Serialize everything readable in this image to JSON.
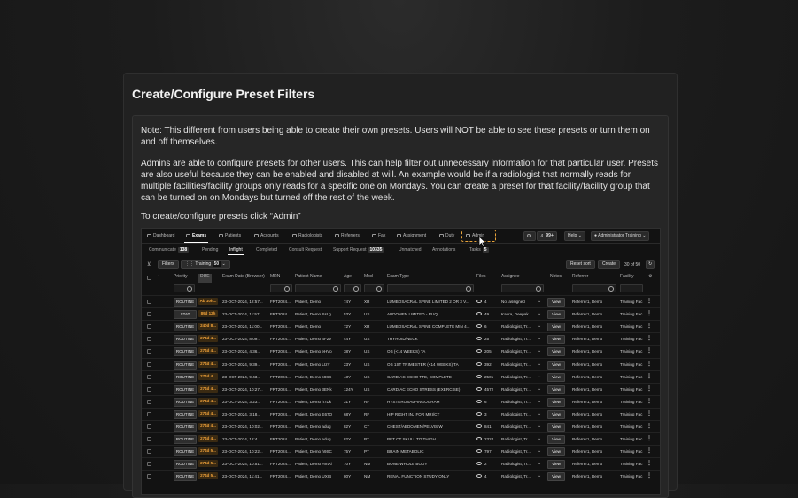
{
  "panel": {
    "title": "Create/Configure Preset Filters",
    "note": "Note: This different from users being able to create their own presets. Users will NOT be able to see these presets or turn them on and off themselves.",
    "description": "Admins are able to configure presets for other users. This can help filter out unnecessary information for that particular user. Presets are also useful because they can be enabled and disabled at will. An example would be if a radiologist that normally reads for multiple facilities/facility groups only reads for a specific one on Mondays. You can create a preset for that facility/facility group that can be turned on on Mondays but turned off the rest of the week.",
    "instruction": "To create/configure presets click “Admin”"
  },
  "app": {
    "nav": [
      "Dashboard",
      "Exams",
      "Patients",
      "Accounts",
      "Radiologists",
      "Referrers",
      "Fax",
      "Assignment",
      "Duty",
      "Admin"
    ],
    "active_nav": "Exams",
    "notif_count": "99+",
    "help_label": "Help",
    "user_name": "Administrator Training",
    "tabs": [
      {
        "label": "Communicate",
        "count": "138"
      },
      {
        "label": "Pending",
        "count": ""
      },
      {
        "label": "Inflight",
        "count": ""
      },
      {
        "label": "Completed",
        "count": ""
      },
      {
        "label": "Consult Request",
        "count": ""
      },
      {
        "label": "Support Request",
        "count": "10335"
      },
      {
        "label": "Unmatched",
        "count": ""
      },
      {
        "label": "Annotations",
        "count": ""
      },
      {
        "label": "Tasks",
        "count": "5"
      }
    ],
    "active_tab": "Inflight",
    "filters_label": "Filters",
    "preset_label": "Training",
    "preset_count": "50",
    "reset_sort_label": "Reset sort",
    "create_label": "Create",
    "pagination": "30 of 50",
    "columns": [
      "Priority",
      "DUE",
      "Exam Date (Browser)",
      "MRN",
      "Patient Name",
      "Age",
      "Mod",
      "Exam Type",
      "Files",
      "Assignee",
      "Notes",
      "Referrer",
      "Facility"
    ],
    "rows": [
      {
        "priority": "ROUTINE",
        "due": "Ab 10h...",
        "date": "23-OCT-2024, 12:57...",
        "mrn": "FRT2024...",
        "name": "Patient, Demo",
        "age": "74Y",
        "mod": "XR",
        "exam": "LUMBOSACRAL SPINE LIMITED 2 OR 3 V...",
        "files": "4",
        "assignee": "Not assigned",
        "referrer": "Referrer1, Demo",
        "facility": "Training Fac"
      },
      {
        "priority": "STAT",
        "due": "89d 12h",
        "date": "23-OCT-2024, 11:57...",
        "mrn": "FRT2024...",
        "name": "Patient, Demo SsLg",
        "age": "53Y",
        "mod": "US",
        "exam": "ABDOMEN LIMITED - RUQ",
        "files": "49",
        "assignee": "Kaura, Deepak",
        "referrer": "Referrer1, Demo",
        "facility": "Training Fac"
      },
      {
        "priority": "ROUTINE",
        "due": "240d 8...",
        "date": "23-OCT-2024, 11:00...",
        "mrn": "FRT2024...",
        "name": "Patient, Demo",
        "age": "72Y",
        "mod": "XR",
        "exam": "LUMBOSACRAL SPINE COMPLETE MIN 4...",
        "files": "6",
        "assignee": "Radiologist, Tr...",
        "referrer": "Referrer1, Demo",
        "facility": "Training Fac"
      },
      {
        "priority": "ROUTINE",
        "due": "274d 4...",
        "date": "23-OCT-2024, 8:09...",
        "mrn": "FRT2024...",
        "name": "Patient, Demo 4F2V",
        "age": "44Y",
        "mod": "US",
        "exam": "THYROID/NECK",
        "files": "25",
        "assignee": "Radiologist, Tr...",
        "referrer": "Referrer1, Demo",
        "facility": "Training Fac"
      },
      {
        "priority": "ROUTINE",
        "due": "274d 4...",
        "date": "23-OCT-2024, 4:36...",
        "mrn": "FRT2024...",
        "name": "Patient, Demo eHVo",
        "age": "38Y",
        "mod": "US",
        "exam": "OB (<14 WEEKS) TA",
        "files": "205",
        "assignee": "Radiologist, Tr...",
        "referrer": "Referrer1, Demo",
        "facility": "Training Fac"
      },
      {
        "priority": "ROUTINE",
        "due": "274d 4...",
        "date": "23-OCT-2024, 9:39...",
        "mrn": "FRT2024...",
        "name": "Patient, Demo LIzY",
        "age": "23Y",
        "mod": "US",
        "exam": "OB 1ST TRIMESTER (<14 WEEKS) TA",
        "files": "392",
        "assignee": "Radiologist, Tr...",
        "referrer": "Referrer1, Demo",
        "facility": "Training Fac"
      },
      {
        "priority": "ROUTINE",
        "due": "274d 4...",
        "date": "23-OCT-2024, 9:43...",
        "mrn": "FRT2024...",
        "name": "Patient, Demo c8SS",
        "age": "43Y",
        "mod": "US",
        "exam": "CARDIAC ECHO TTE, COMPLETE",
        "files": "2501",
        "assignee": "Radiologist, Tr...",
        "referrer": "Referrer1, Demo",
        "facility": "Training Fac"
      },
      {
        "priority": "ROUTINE",
        "due": "274d 4...",
        "date": "23-OCT-2024, 10:27...",
        "mrn": "FRT2024...",
        "name": "Patient, Demo 3ENk",
        "age": "124Y",
        "mod": "US",
        "exam": "CARDIAC ECHO STRESS (EXERCISE)",
        "files": "4572",
        "assignee": "Radiologist, Tr...",
        "referrer": "Referrer1, Demo",
        "facility": "Training Fac"
      },
      {
        "priority": "ROUTINE",
        "due": "274d 4...",
        "date": "23-OCT-2024, 3:23...",
        "mrn": "FRT2024...",
        "name": "Patient, Demo h7Dk",
        "age": "31Y",
        "mod": "RF",
        "exam": "HYSTEROSALPINGOGRAM",
        "files": "6",
        "assignee": "Radiologist, Tr...",
        "referrer": "Referrer1, Demo",
        "facility": "Training Fac"
      },
      {
        "priority": "ROUTINE",
        "due": "274d 4...",
        "date": "23-OCT-2024, 3:18...",
        "mrn": "FRT2024...",
        "name": "Patient, Demo E67O",
        "age": "68Y",
        "mod": "RF",
        "exam": "HIP RIGHT INJ FOR MRI/CT",
        "files": "3",
        "assignee": "Radiologist, Tr...",
        "referrer": "Referrer1, Demo",
        "facility": "Training Fac"
      },
      {
        "priority": "ROUTINE",
        "due": "274d 4...",
        "date": "23-OCT-2024, 10:02...",
        "mrn": "FRT2024...",
        "name": "Patient, Demo adug",
        "age": "82Y",
        "mod": "CT",
        "exam": "CHEST/ABDOMEN/PELVIS W",
        "files": "841",
        "assignee": "Radiologist, Tr...",
        "referrer": "Referrer1, Demo",
        "facility": "Training Fac"
      },
      {
        "priority": "ROUTINE",
        "due": "274d 4...",
        "date": "23-OCT-2024, 12:4...",
        "mrn": "FRT2024...",
        "name": "Patient, Demo adug",
        "age": "82Y",
        "mod": "PT",
        "exam": "PET CT SKULL TO THIGH",
        "files": "2324",
        "assignee": "Radiologist, Tr...",
        "referrer": "Referrer1, Demo",
        "facility": "Training Fac"
      },
      {
        "priority": "ROUTINE",
        "due": "274d 5...",
        "date": "23-OCT-2024, 10:22...",
        "mrn": "FRT2024...",
        "name": "Patient, Demo h9SC",
        "age": "75Y",
        "mod": "PT",
        "exam": "BRAIN METABOLIC",
        "files": "797",
        "assignee": "Radiologist, Tr...",
        "referrer": "Referrer1, Demo",
        "facility": "Training Fac"
      },
      {
        "priority": "ROUTINE",
        "due": "274d 5...",
        "date": "23-OCT-2024, 10:51...",
        "mrn": "FRT2024...",
        "name": "Patient, Demo HmAi",
        "age": "70Y",
        "mod": "NM",
        "exam": "BONE WHOLE BODY",
        "files": "2",
        "assignee": "Radiologist, Tr...",
        "referrer": "Referrer1, Demo",
        "facility": "Training Fac"
      },
      {
        "priority": "ROUTINE",
        "due": "274d 5...",
        "date": "23-OCT-2024, 11:41...",
        "mrn": "FRT2024...",
        "name": "Patient, Demo UXIB",
        "age": "80Y",
        "mod": "NM",
        "exam": "RENAL FUNCTION STUDY ONLY",
        "files": "4",
        "assignee": "Radiologist, Tr...",
        "referrer": "Referrer1, Demo",
        "facility": "Training Fac"
      }
    ],
    "view_label": "View"
  },
  "colors": {
    "highlight": "#e8a33a",
    "due_text": "#f4a43a",
    "panel_bg": "#212121"
  }
}
